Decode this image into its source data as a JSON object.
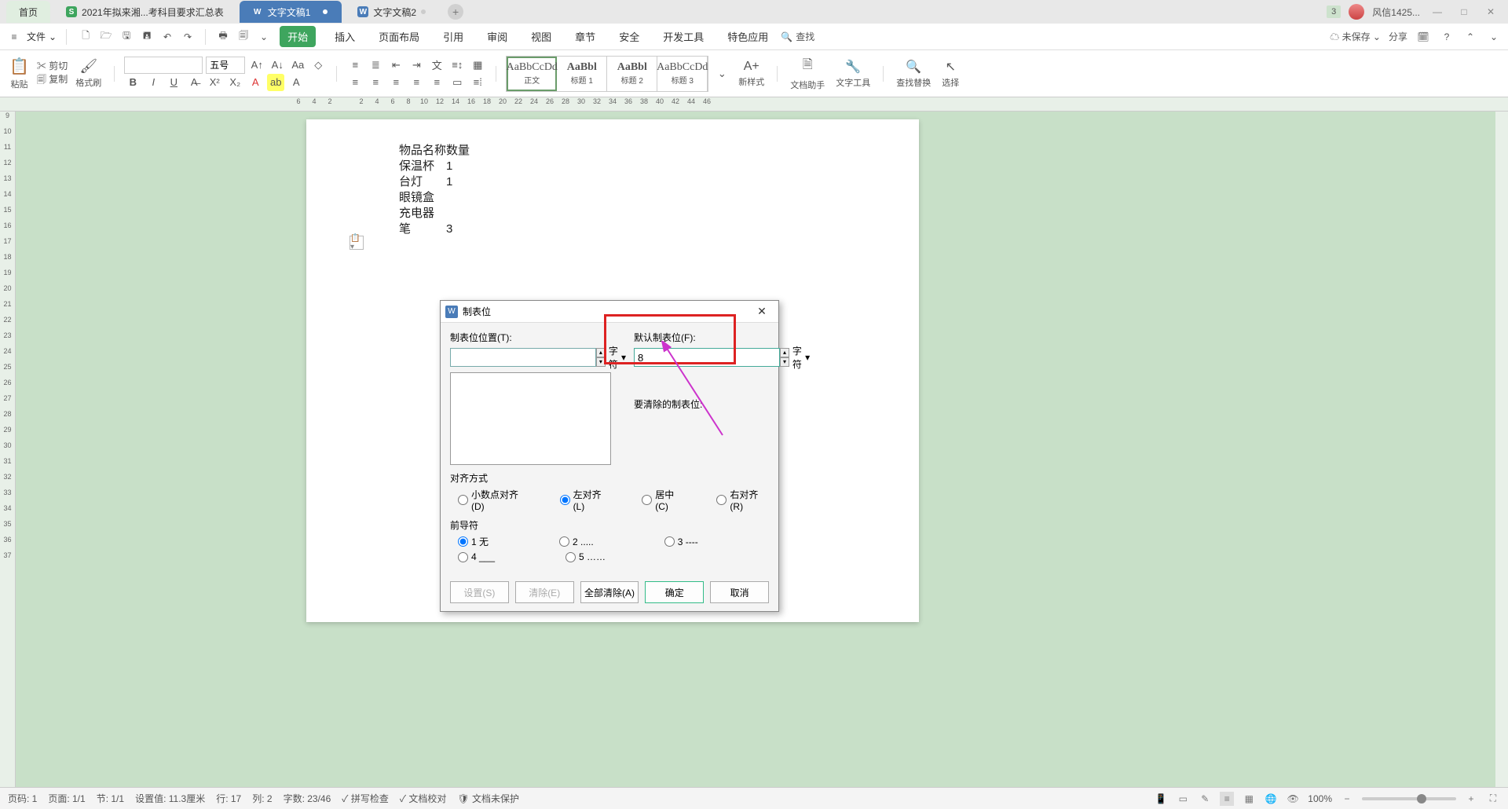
{
  "tabs": {
    "home": "首页",
    "excel": "2021年拟来湘...考科目要求汇总表",
    "doc1": "文字文稿1",
    "doc2": "文字文稿2"
  },
  "titlebar_right": {
    "badge": "3",
    "username": "风信1425..."
  },
  "file_menu": "文件",
  "ribbon_tabs": [
    "开始",
    "插入",
    "页面布局",
    "引用",
    "审阅",
    "视图",
    "章节",
    "安全",
    "开发工具",
    "特色应用"
  ],
  "search_placeholder": "查找",
  "quick_right": {
    "unsaved": "未保存",
    "share": "分享"
  },
  "clipboard": {
    "paste": "粘贴",
    "cut": "剪切",
    "copy": "复制",
    "format_painter": "格式刷"
  },
  "font": {
    "name": "",
    "size": "五号"
  },
  "styles": {
    "sample": "AaBbCcDd",
    "sample_big": "AaBbl",
    "items": [
      "正文",
      "标题 1",
      "标题 2",
      "标题 3"
    ]
  },
  "ribbon_right": {
    "new_style": "新样式",
    "doc_helper": "文档助手",
    "text_tool": "文字工具",
    "find_replace": "查找替换",
    "select": "选择"
  },
  "document": {
    "rows": [
      [
        "物品名称",
        "数量"
      ],
      [
        "保温杯",
        "1"
      ],
      [
        "台灯",
        "1"
      ],
      [
        "眼镜盒",
        ""
      ],
      [
        "充电器",
        ""
      ],
      [
        "笔",
        "3"
      ]
    ]
  },
  "dialog": {
    "title": "制表位",
    "tab_pos_label": "制表位位置(T):",
    "default_tab_label": "默认制表位(F):",
    "default_tab_value": "8",
    "unit": "字符",
    "clear_label": "要清除的制表位:",
    "align_section": "对齐方式",
    "align": {
      "decimal": "小数点对齐(D)",
      "left": "左对齐(L)",
      "center": "居中(C)",
      "right": "右对齐(R)"
    },
    "leader_section": "前导符",
    "leader": {
      "l1": "1 无",
      "l2": "2 .....",
      "l3": "3 ----",
      "l4": "4 ___",
      "l5": "5 ……"
    },
    "buttons": {
      "set": "设置(S)",
      "clear": "清除(E)",
      "clear_all": "全部清除(A)",
      "ok": "确定",
      "cancel": "取消"
    }
  },
  "status": {
    "page_no": "页码: 1",
    "page": "页面: 1/1",
    "section": "节: 1/1",
    "setting": "设置值: 11.3厘米",
    "row": "行: 17",
    "col": "列: 2",
    "chars": "字数: 23/46",
    "spell": "拼写检查",
    "proof": "文档校对",
    "protect": "文档未保护",
    "zoom": "100%"
  },
  "ruler_h": [
    "6",
    "4",
    "2",
    "",
    "2",
    "4",
    "6",
    "8",
    "10",
    "12",
    "14",
    "16",
    "18",
    "20",
    "22",
    "24",
    "26",
    "28",
    "30",
    "32",
    "34",
    "36",
    "38",
    "40",
    "42",
    "44",
    "46"
  ],
  "ruler_v": [
    "9",
    "10",
    "11",
    "12",
    "13",
    "14",
    "15",
    "16",
    "17",
    "18",
    "19",
    "20",
    "21",
    "22",
    "23",
    "24",
    "25",
    "26",
    "27",
    "28",
    "29",
    "30",
    "31",
    "32",
    "33",
    "34",
    "35",
    "36",
    "37"
  ]
}
